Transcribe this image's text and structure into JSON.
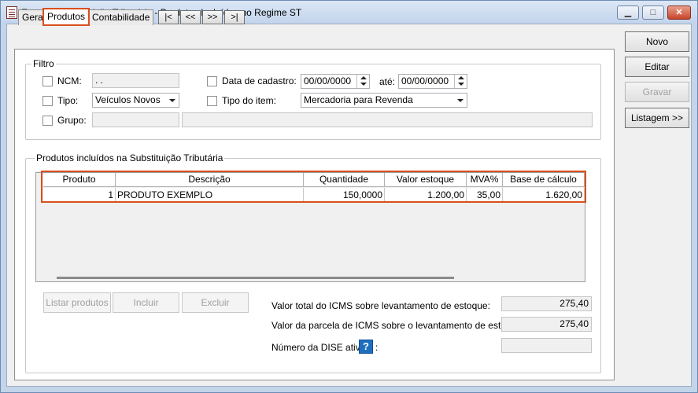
{
  "window": {
    "title": "Estoque Substituição Tributária - Produtos Incluídos no Regime ST",
    "minimize": "▁",
    "maximize": "□",
    "close": "✕"
  },
  "tabs": [
    "Geral",
    "Produtos",
    "Contabilidade"
  ],
  "nav_buttons": [
    "|<",
    "<<",
    ">>",
    ">|"
  ],
  "filtro": {
    "legend": "Filtro",
    "ncm_label": "NCM:",
    "ncm_value": " .  . ",
    "tipo_label": "Tipo:",
    "tipo_value": "Veículos Novos",
    "grupo_label": "Grupo:",
    "data_cadastro_label": "Data de cadastro:",
    "data_from": "00/00/0000",
    "ate_label": "até:",
    "data_to": "00/00/0000",
    "tipo_item_label": "Tipo do item:",
    "tipo_item_value": "Mercadoria para Revenda"
  },
  "produtos": {
    "legend": "Produtos incluídos na Substituição Tributária",
    "columns": [
      "Produto",
      "Descrição",
      "Quantidade",
      "Valor estoque",
      "MVA%",
      "Base de cálculo"
    ],
    "rows": [
      [
        "1",
        "PRODUTO EXEMPLO",
        "150,0000",
        "1.200,00",
        "35,00",
        "1.620,00"
      ]
    ]
  },
  "actions": {
    "listar": "Listar produtos",
    "incluir": "Incluir",
    "excluir": "Excluir"
  },
  "totals": {
    "icms_total_label": "Valor total do ICMS sobre levantamento de estoque:",
    "icms_total_value": "275,40",
    "icms_parcela_label": "Valor da parcela de ICMS sobre o levantamento de estoque:",
    "icms_parcela_value": "275,40",
    "dise_label": "Número da DISE ativa",
    "dise_colon": ":",
    "dise_value": "",
    "help_glyph": "?"
  },
  "side_buttons": {
    "novo": "Novo",
    "editar": "Editar",
    "gravar": "Gravar",
    "listagem": "Listagem >>"
  }
}
